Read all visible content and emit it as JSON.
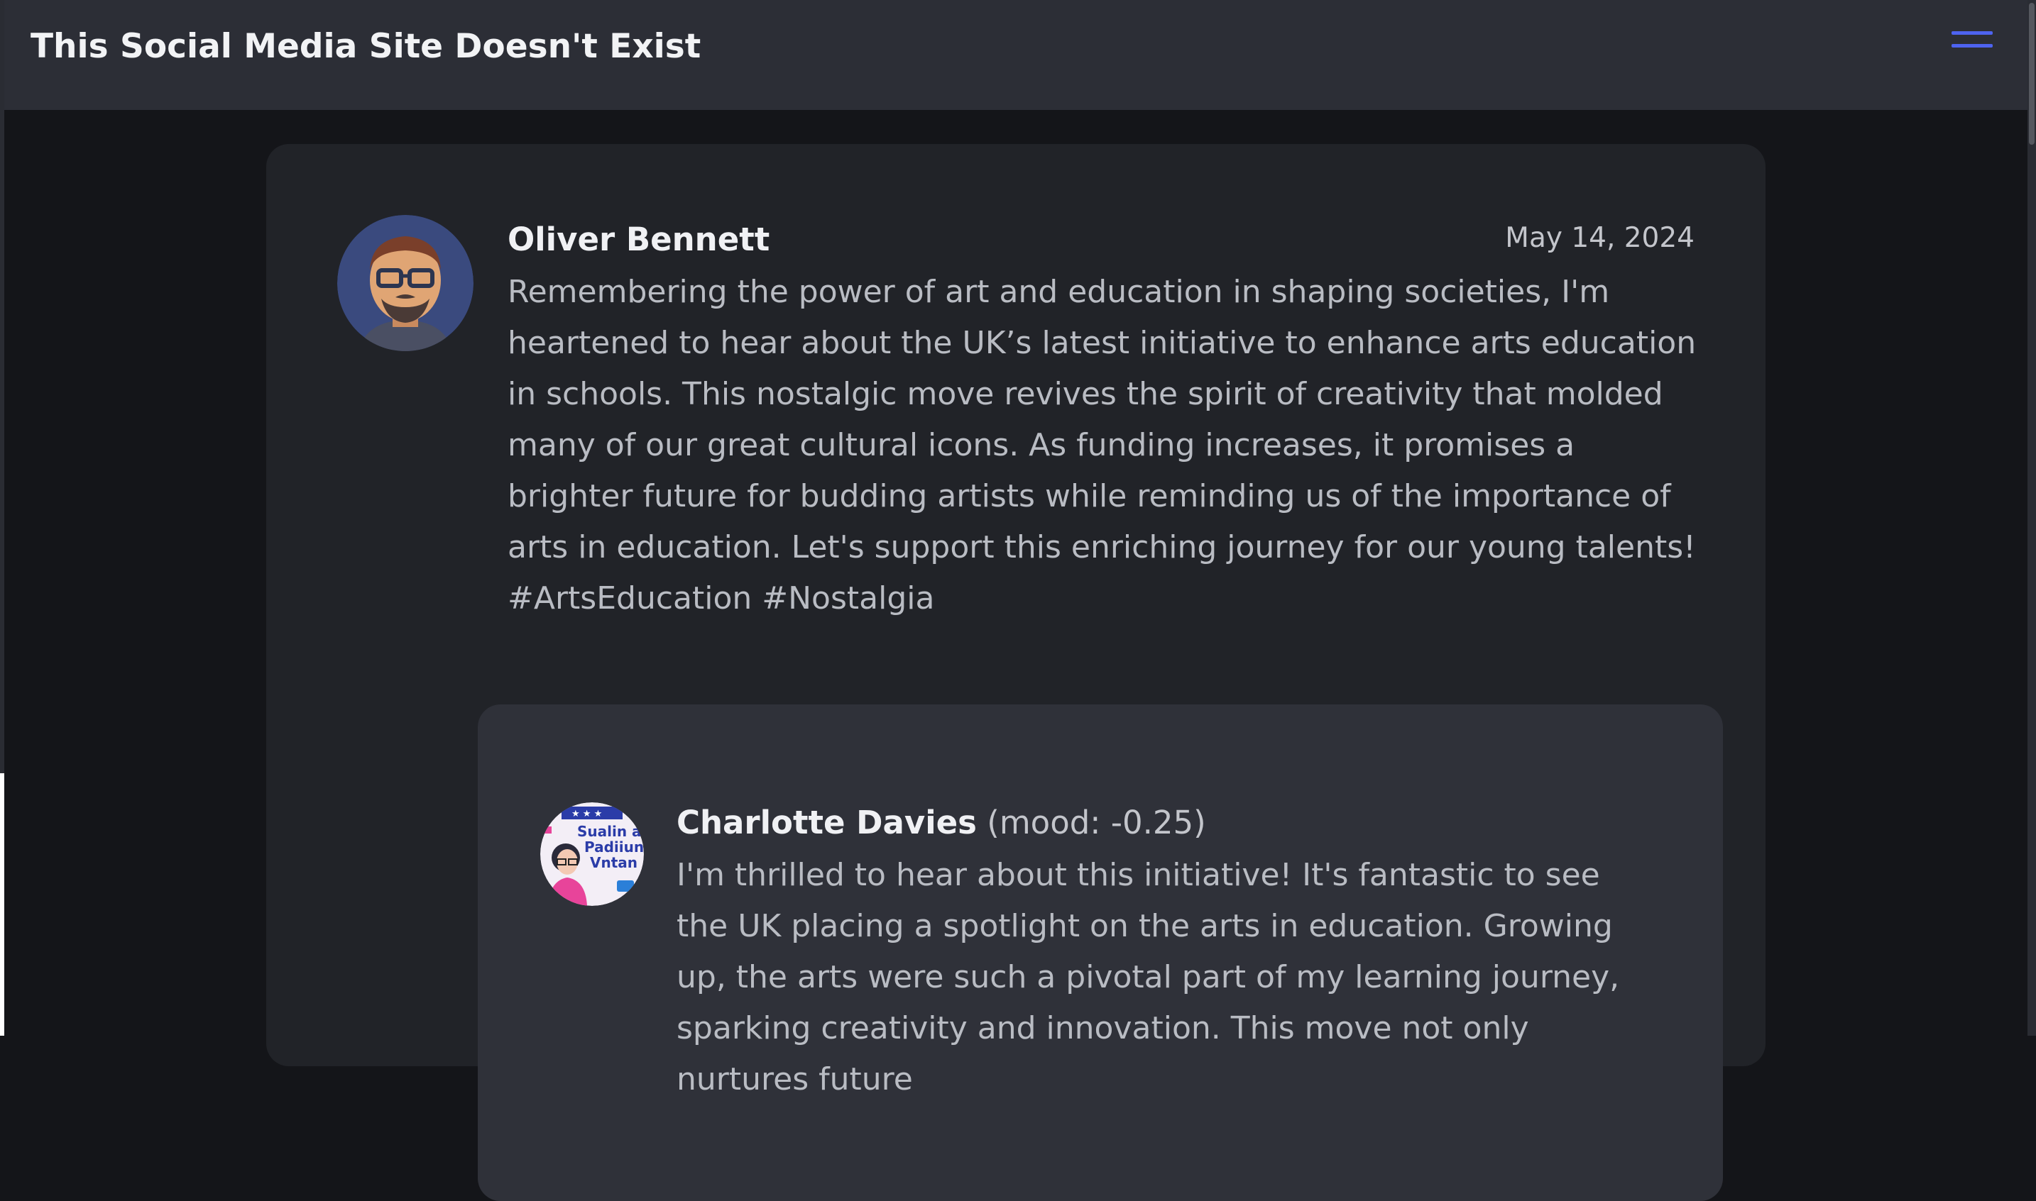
{
  "navbar": {
    "title": "This Social Media Site Doesn't Exist",
    "menu_icon": "hamburger-menu-icon",
    "accent_color": "#4e63f0"
  },
  "post": {
    "author": "Oliver Bennett",
    "date": "May 14, 2024",
    "text": "Remembering the power of art and education in shaping societies, I'm heartened to hear about the UK’s latest initiative to enhance arts education in schools. This nostalgic move revives the spirit of creativity that molded many of our great cultural icons. As funding increases, it promises a brighter future for budding artists while reminding us of the importance of arts in education. Let's support this enriching journey for our young talents! #ArtsEducation #Nostalgia",
    "avatar_icon": "bearded-man-avatar-icon"
  },
  "reply": {
    "author": "Charlotte Davies",
    "mood": "(mood: -0.25)",
    "text": "I'm thrilled to hear about this initiative! It's fantastic to see the UK placing a spotlight on the arts in education. Growing up, the arts were such a pivotal part of my learning journey, sparking creativity and innovation. This move not only nurtures future",
    "avatar_icon": "campaign-poster-avatar-icon",
    "avatar_lettering": [
      "Sualin a",
      "Padiiun",
      "Vntan"
    ]
  }
}
